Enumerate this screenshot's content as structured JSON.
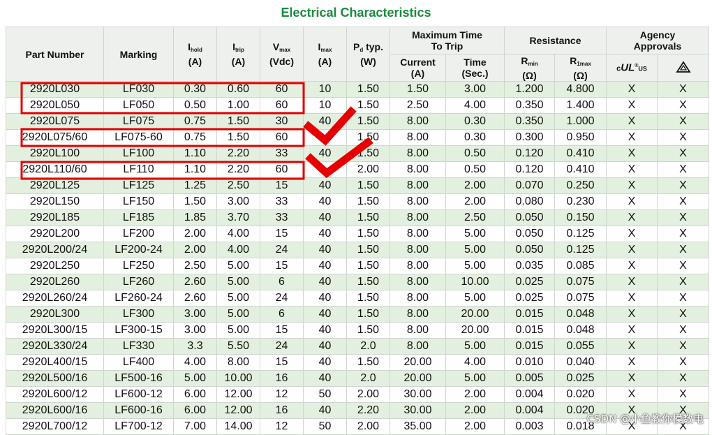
{
  "title": "Electrical Characteristics",
  "headers": {
    "part_number": "Part Number",
    "marking": "Marking",
    "ihold_main": "I",
    "ihold_sub": "hold",
    "ihold_unit": "(A)",
    "itrip_main": "I",
    "itrip_sub": "trip",
    "itrip_unit": "(A)",
    "vmax_main": "V",
    "vmax_sub": "max",
    "vmax_unit": "(Vdc)",
    "imax_main": "I",
    "imax_sub": "max",
    "imax_unit": "(A)",
    "pd_main": "P",
    "pd_sub": "d",
    "pd_typ": "typ.",
    "pd_unit": "(W)",
    "max_time_line1": "Maximum Time",
    "max_time_line2": "To Trip",
    "current_label": "Current",
    "current_unit": "(A)",
    "time_label": "Time",
    "time_unit": "(Sec.)",
    "resistance": "Resistance",
    "rmin_main": "R",
    "rmin_sub": "min",
    "rmin_unit": "(Ω)",
    "r1max_main": "R",
    "r1max_sub": "1max",
    "r1max_unit": "(Ω)",
    "agency_line1": "Agency",
    "agency_line2": "Approvals",
    "ul_c": "c",
    "ul_mark": "UL",
    "ul_us": "US",
    "ul_reg": "®"
  },
  "rows": [
    [
      "2920L030",
      "LF030",
      "0.30",
      "0.60",
      "60",
      "10",
      "1.50",
      "1.50",
      "3.00",
      "1.200",
      "4.800",
      "X",
      "X"
    ],
    [
      "2920L050",
      "LF050",
      "0.50",
      "1.00",
      "60",
      "10",
      "1.50",
      "2.50",
      "4.00",
      "0.350",
      "1.400",
      "X",
      "X"
    ],
    [
      "2920L075",
      "LF075",
      "0.75",
      "1.50",
      "30",
      "40",
      "1.50",
      "8.00",
      "0.30",
      "0.350",
      "1.000",
      "X",
      "X"
    ],
    [
      "2920L075/60",
      "LF075-60",
      "0.75",
      "1.50",
      "60",
      "",
      "1.50",
      "8.00",
      "0.30",
      "0.300",
      "0.950",
      "X",
      "X"
    ],
    [
      "2920L100",
      "LF100",
      "1.10",
      "2.20",
      "33",
      "40",
      "1.50",
      "8.00",
      "0.50",
      "0.120",
      "0.410",
      "X",
      "X"
    ],
    [
      "2920L110/60",
      "LF110",
      "1.10",
      "2.20",
      "60",
      "",
      "2.00",
      "8.00",
      "0.50",
      "0.120",
      "0.410",
      "X",
      "X"
    ],
    [
      "2920L125",
      "LF125",
      "1.25",
      "2.50",
      "15",
      "40",
      "1.50",
      "8.00",
      "2.00",
      "0.070",
      "0.250",
      "X",
      "X"
    ],
    [
      "2920L150",
      "LF150",
      "1.50",
      "3.00",
      "33",
      "40",
      "1.50",
      "8.00",
      "2.00",
      "0.080",
      "0.230",
      "X",
      "X"
    ],
    [
      "2920L185",
      "LF185",
      "1.85",
      "3.70",
      "33",
      "40",
      "1.50",
      "8.00",
      "2.50",
      "0.050",
      "0.150",
      "X",
      "X"
    ],
    [
      "2920L200",
      "LF200",
      "2.00",
      "4.00",
      "15",
      "40",
      "1.50",
      "8.00",
      "5.00",
      "0.050",
      "0.125",
      "X",
      "X"
    ],
    [
      "2920L200/24",
      "LF200-24",
      "2.00",
      "4.00",
      "24",
      "40",
      "1.50",
      "8.00",
      "5.00",
      "0.050",
      "0.125",
      "X",
      "X"
    ],
    [
      "2920L250",
      "LF250",
      "2.50",
      "5.00",
      "15",
      "40",
      "1.50",
      "8.00",
      "5.00",
      "0.035",
      "0.085",
      "X",
      "X"
    ],
    [
      "2920L260",
      "LF260",
      "2.60",
      "5.00",
      "6",
      "40",
      "1.50",
      "8.00",
      "10.00",
      "0.025",
      "0.075",
      "X",
      "X"
    ],
    [
      "2920L260/24",
      "LF260-24",
      "2.60",
      "5.00",
      "24",
      "40",
      "1.50",
      "8.00",
      "5.00",
      "0.025",
      "0.075",
      "X",
      "X"
    ],
    [
      "2920L300",
      "LF300",
      "3.00",
      "5.00",
      "6",
      "40",
      "1.50",
      "8.00",
      "20.00",
      "0.015",
      "0.048",
      "X",
      "X"
    ],
    [
      "2920L300/15",
      "LF300-15",
      "3.00",
      "5.00",
      "15",
      "40",
      "1.50",
      "8.00",
      "20.00",
      "0.015",
      "0.048",
      "X",
      "X"
    ],
    [
      "2920L330/24",
      "LF330",
      "3.3",
      "5.50",
      "24",
      "40",
      "2.0",
      "8.00",
      "5.00",
      "0.015",
      "0.055",
      "X",
      "X"
    ],
    [
      "2920L400/15",
      "LF400",
      "4.00",
      "8.00",
      "15",
      "40",
      "1.50",
      "20.00",
      "4.00",
      "0.010",
      "0.040",
      "X",
      "X"
    ],
    [
      "2920L500/16",
      "LF500-16",
      "5.00",
      "10.00",
      "16",
      "40",
      "2.0",
      "20.00",
      "5.00",
      "0.005",
      "0.025",
      "X",
      "X"
    ],
    [
      "2920L600/12",
      "LF600-12",
      "6.00",
      "12.00",
      "12",
      "50",
      "2.00",
      "30.00",
      "2.00",
      "0.004",
      "0.020",
      "X",
      "X"
    ],
    [
      "2920L600/16",
      "LF600-16",
      "6.00",
      "12.00",
      "16",
      "40",
      "2.20",
      "30.00",
      "2.00",
      "0.004",
      "0.020",
      "X",
      "X"
    ],
    [
      "2920L700/12",
      "LF700-12",
      "7.00",
      "14.00",
      "12",
      "50",
      "2.00",
      "35.00",
      "2.00",
      "0.003",
      "0.018",
      "X",
      "X"
    ]
  ],
  "colors": {
    "title": "#1a8a3c",
    "row_shade": "#e3f0df",
    "header_bg": "#eef0ee",
    "annotation_red": "#e00000"
  },
  "watermark": "CSDN @小鱼教你模数电"
}
